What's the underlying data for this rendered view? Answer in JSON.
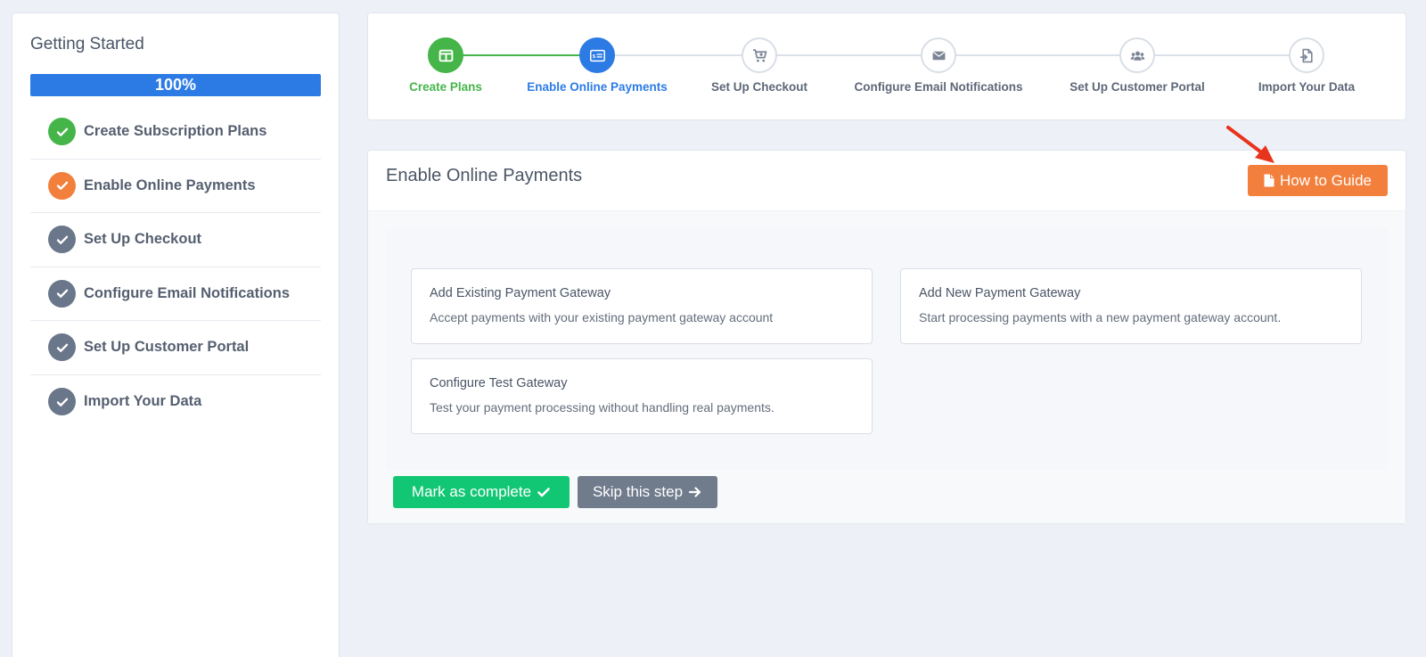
{
  "sidebar": {
    "title": "Getting Started",
    "progress_label": "100%",
    "progress_value": 100,
    "items": [
      {
        "label": "Create Subscription Plans",
        "status": "done"
      },
      {
        "label": "Enable Online Payments",
        "status": "current"
      },
      {
        "label": "Set Up Checkout",
        "status": "todo"
      },
      {
        "label": "Configure Email Notifications",
        "status": "todo"
      },
      {
        "label": "Set Up Customer Portal",
        "status": "todo"
      },
      {
        "label": "Import Your Data",
        "status": "todo"
      }
    ]
  },
  "stepper": {
    "steps": [
      {
        "label": "Create Plans",
        "icon": "columns-icon",
        "state": "done"
      },
      {
        "label": "Enable Online Payments",
        "icon": "credit-card-icon",
        "state": "active"
      },
      {
        "label": "Set Up Checkout",
        "icon": "cart-icon",
        "state": "pending"
      },
      {
        "label": "Configure Email Notifications",
        "icon": "envelope-icon",
        "state": "pending"
      },
      {
        "label": "Set Up Customer Portal",
        "icon": "users-icon",
        "state": "pending"
      },
      {
        "label": "Import Your Data",
        "icon": "file-import-icon",
        "state": "pending"
      }
    ]
  },
  "main": {
    "title": "Enable Online Payments",
    "guide_button": "How to Guide",
    "options": [
      {
        "title": "Add Existing Payment Gateway",
        "desc": "Accept payments with your existing payment gateway account"
      },
      {
        "title": "Add New Payment Gateway",
        "desc": "Start processing payments with a new payment gateway account."
      },
      {
        "title": "Configure Test Gateway",
        "desc": "Test your payment processing without handling real payments."
      }
    ],
    "complete_button": "Mark as complete",
    "skip_button": "Skip this step"
  },
  "colors": {
    "green": "#45b549",
    "blue": "#2c7be5",
    "orange": "#f37f3c",
    "gray": "#6a7689",
    "success": "#12c774",
    "annotation_arrow": "#e8341c"
  }
}
